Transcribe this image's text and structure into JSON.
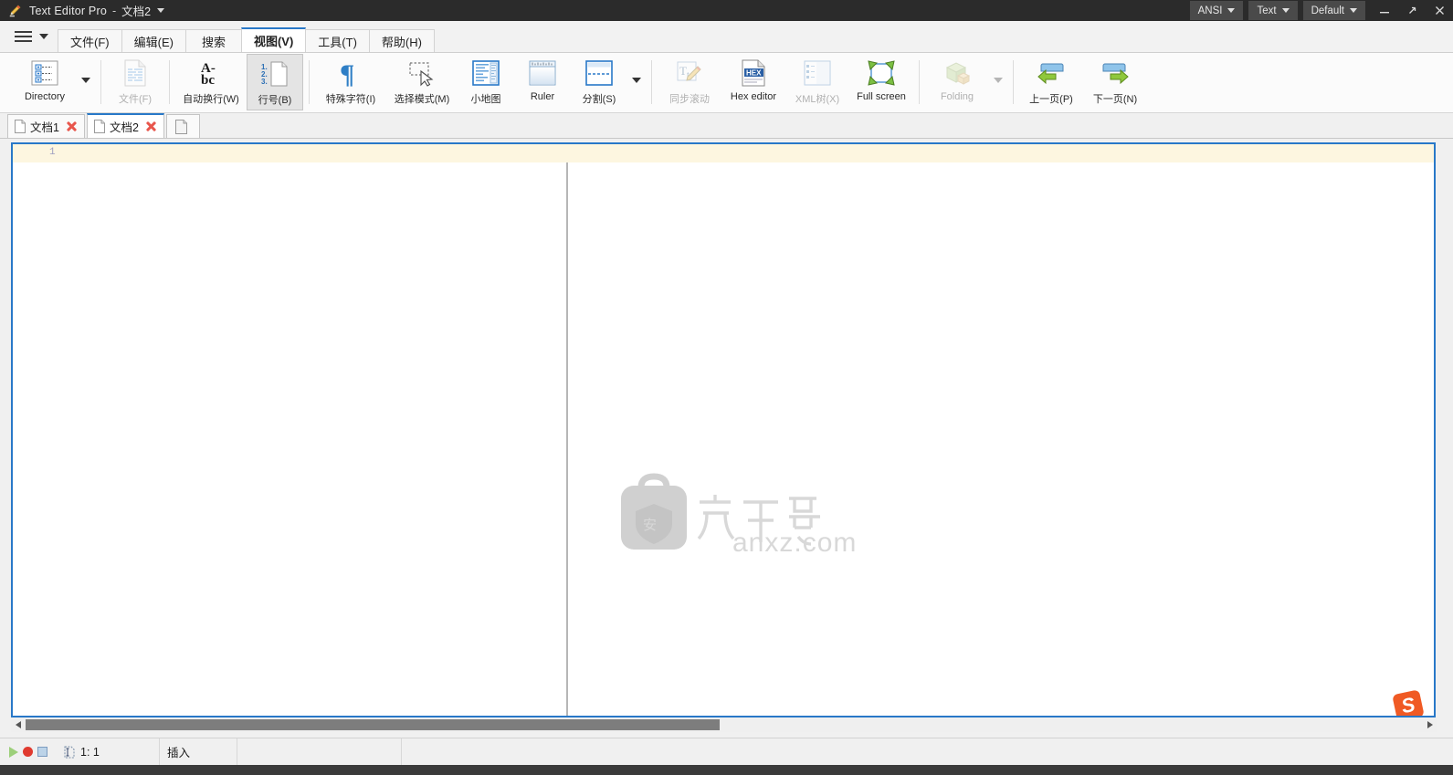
{
  "window": {
    "app_title": "Text Editor Pro",
    "separator": "-",
    "document_name": "文档2",
    "app_icon": "pencil-icon",
    "dropdown_icon": "chevron-down-icon"
  },
  "titlebar_controls": {
    "encoding": "ANSI",
    "syntax": "Text",
    "scheme": "Default",
    "minimize": "—",
    "maximize": "↗",
    "close": "✕"
  },
  "menubar": {
    "hamburger_icon": "hamburger-menu-icon",
    "hamburger_caret": "chevron-down-icon",
    "items": [
      {
        "label": "文件(F)",
        "active": false
      },
      {
        "label": "编辑(E)",
        "active": false
      },
      {
        "label": "搜索",
        "active": false
      },
      {
        "label": "视图(V)",
        "active": true
      },
      {
        "label": "工具(T)",
        "active": false
      },
      {
        "label": "帮助(H)",
        "active": false
      }
    ]
  },
  "ribbon": {
    "items": [
      {
        "label": "Directory",
        "icon": "directory-tree-icon",
        "state": "normal",
        "width": "wide"
      },
      {
        "label": "文件(F)",
        "icon": "file-lines-icon",
        "state": "disabled",
        "width": "normal"
      },
      {
        "label": "自动换行(W)",
        "icon": "word-wrap-abc-icon",
        "state": "normal",
        "width": "xwide"
      },
      {
        "label": "行号(B)",
        "icon": "line-numbers-icon",
        "state": "active",
        "width": "normal"
      },
      {
        "label": "特殊字符(I)",
        "icon": "pilcrow-icon",
        "state": "normal",
        "width": "xwide"
      },
      {
        "label": "选择模式(M)",
        "icon": "selection-mode-cursor-icon",
        "state": "normal",
        "width": "xwide"
      },
      {
        "label": "小地图",
        "icon": "minimap-icon",
        "state": "normal",
        "width": "normal"
      },
      {
        "label": "Ruler",
        "icon": "ruler-icon",
        "state": "normal",
        "width": "normal"
      },
      {
        "label": "分割(S)",
        "icon": "split-view-icon",
        "state": "normal",
        "width": "normal"
      },
      {
        "label": "同步滚动",
        "icon": "sync-edit-pencil-icon",
        "state": "disabled",
        "width": "wide"
      },
      {
        "label": "Hex editor",
        "icon": "hex-file-icon",
        "state": "normal",
        "width": "wide"
      },
      {
        "label": "XML树(X)",
        "icon": "xml-tree-icon",
        "state": "disabled",
        "width": "wide"
      },
      {
        "label": "Full screen",
        "icon": "full-screen-icon",
        "state": "normal",
        "width": "wide"
      },
      {
        "label": "Folding",
        "icon": "folding-cube-icon",
        "state": "disabled",
        "width": "wide"
      },
      {
        "label": "上一页(P)",
        "icon": "previous-page-arrow-icon",
        "state": "normal",
        "width": "wide"
      },
      {
        "label": "下一页(N)",
        "icon": "next-page-arrow-icon",
        "state": "normal",
        "width": "wide"
      }
    ],
    "dropdown_icon": "chevron-down-icon"
  },
  "doc_tabs": [
    {
      "label": "文档1",
      "active": false,
      "icon": "file-icon",
      "close_icon": "close-icon"
    },
    {
      "label": "文档2",
      "active": true,
      "icon": "file-icon",
      "close_icon": "close-icon"
    }
  ],
  "new_tab": {
    "icon": "new-file-icon"
  },
  "editor": {
    "line_number": "1",
    "content": "",
    "watermark_text": "anxz.com",
    "watermark_glyph": "安下载",
    "ime_badge": "S"
  },
  "scrollbar": {
    "left_arrow": "arrow-left-icon",
    "right_arrow": "arrow-right-icon"
  },
  "statusbar": {
    "macro_play": "macro-play-icon",
    "macro_record": "macro-record-icon",
    "macro_stop": "macro-stop-icon",
    "position_icon": "caret-position-icon",
    "position": "1: 1",
    "insert_mode": "插入",
    "extra_cell": ""
  },
  "colors": {
    "titlebar_bg": "#2b2b2b",
    "accent": "#2878c8",
    "current_line": "#fdf6e0",
    "close_red": "#e8564c",
    "ime_orange": "#f05a24"
  }
}
